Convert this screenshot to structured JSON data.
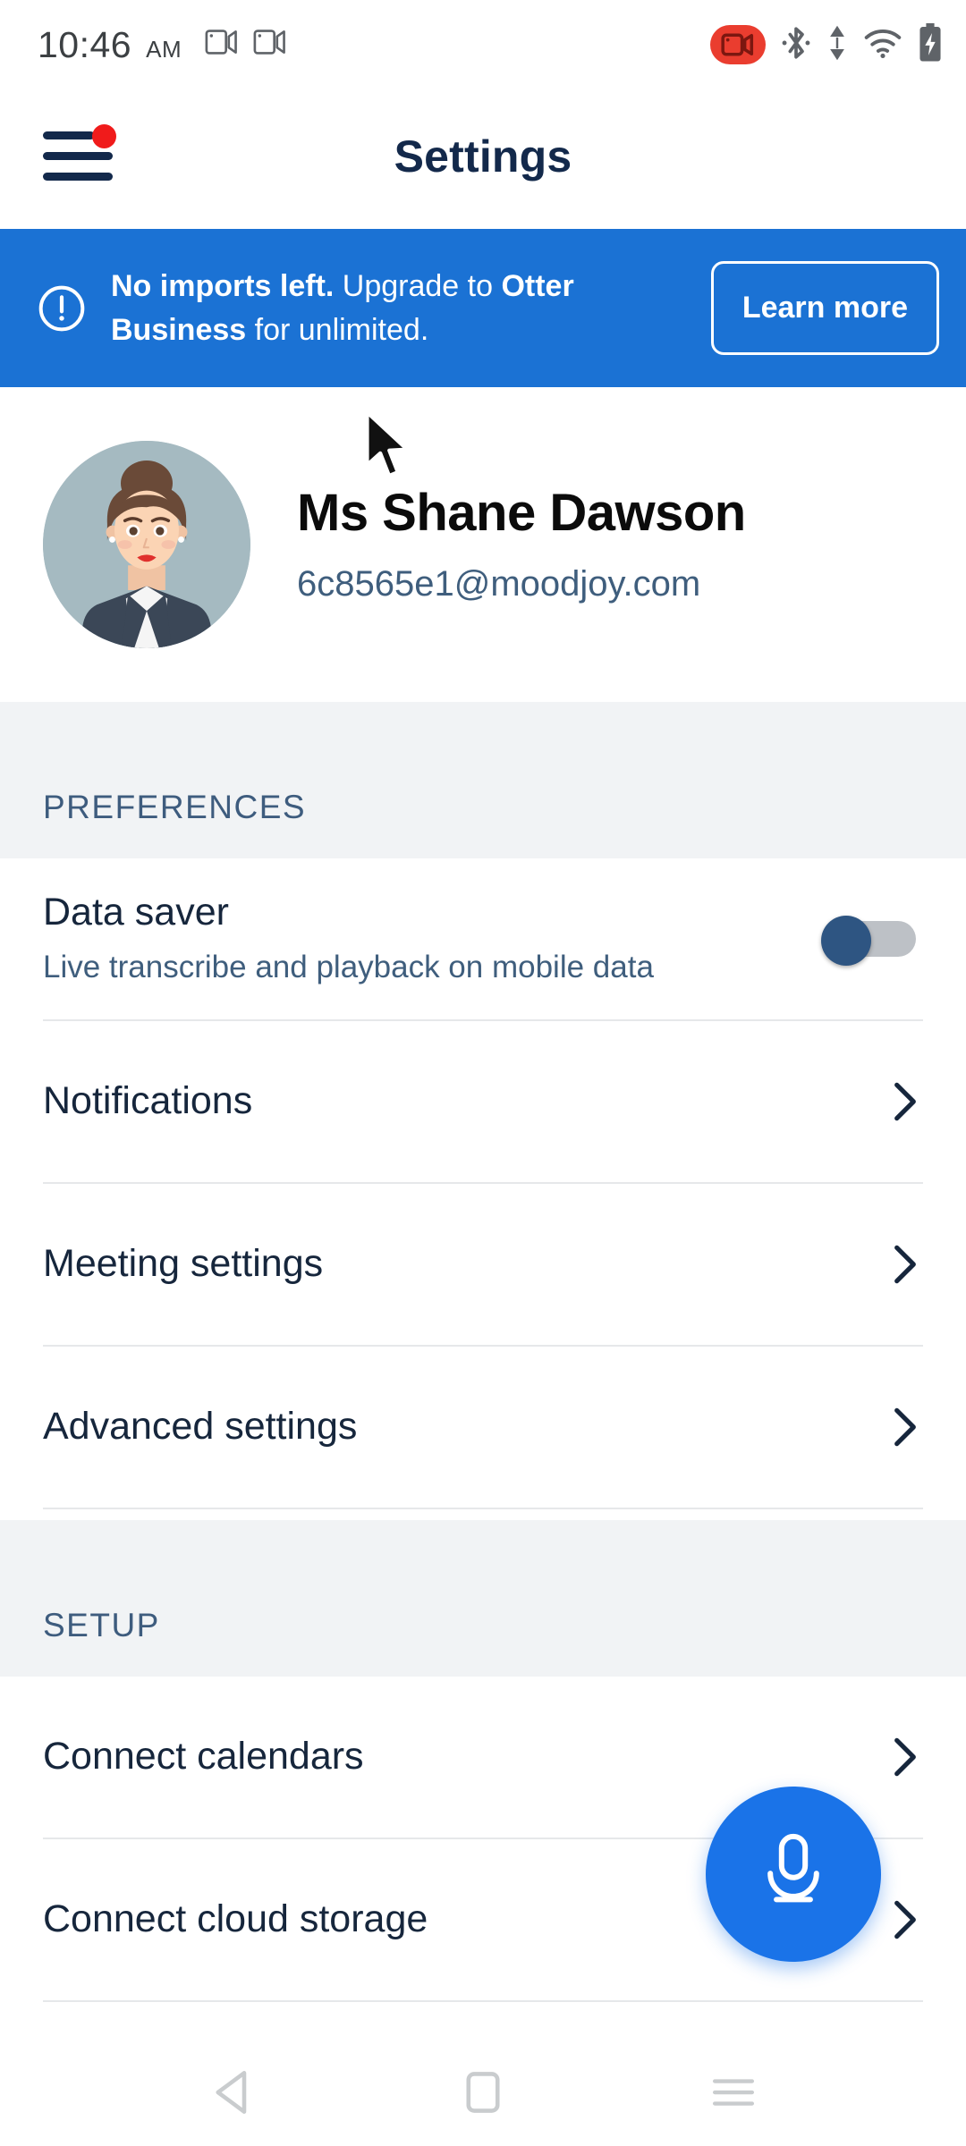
{
  "statusbar": {
    "time": "10:46",
    "ampm": "AM",
    "icons_left": [
      "screen-cast-icon",
      "screen-cast-icon"
    ],
    "icons_right": [
      "screen-record-icon",
      "bluetooth-icon",
      "data-transfer-icon",
      "wifi-icon",
      "battery-charging-icon"
    ],
    "record_badge_color": "#ea3d2f"
  },
  "appbar": {
    "menu_icon": "hamburger-menu-icon",
    "has_notification_dot": true,
    "notification_dot_color": "#f01b1b",
    "title": "Settings"
  },
  "banner": {
    "icon": "alert-circle-icon",
    "background_color": "#1b72d4",
    "text_bold_1": "No imports left.",
    "text_normal_1": " Upgrade to ",
    "text_bold_2": "Otter Business",
    "text_normal_2": " for unlimited.",
    "button_label": "Learn more"
  },
  "profile": {
    "avatar": "user-avatar-illustration",
    "avatar_background": "#a5bac1",
    "name": "Ms Shane Dawson",
    "email": "6c8565e1@moodjoy.com"
  },
  "sections": [
    {
      "header": "PREFERENCES",
      "rows": [
        {
          "title": "Data saver",
          "subtitle": "Live transcribe and playback on mobile data",
          "control": "toggle",
          "toggle_on": false,
          "toggle_knob_color": "#2e5582",
          "toggle_track_color": "#bdc1c6"
        },
        {
          "title": "Notifications",
          "subtitle": "",
          "control": "chevron"
        },
        {
          "title": "Meeting settings",
          "subtitle": "",
          "control": "chevron"
        },
        {
          "title": "Advanced settings",
          "subtitle": "",
          "control": "chevron"
        }
      ]
    },
    {
      "header": "SETUP",
      "rows": [
        {
          "title": "Connect calendars",
          "subtitle": "",
          "control": "chevron"
        },
        {
          "title": "Connect cloud storage",
          "subtitle": "",
          "control": "chevron"
        }
      ]
    }
  ],
  "fab": {
    "icon": "microphone-icon",
    "color": "#1a73e8"
  },
  "navbar": {
    "back": "back-triangle-icon",
    "home": "home-square-icon",
    "recents": "recents-lines-icon"
  },
  "cursor": {
    "icon": "mouse-pointer-icon"
  }
}
